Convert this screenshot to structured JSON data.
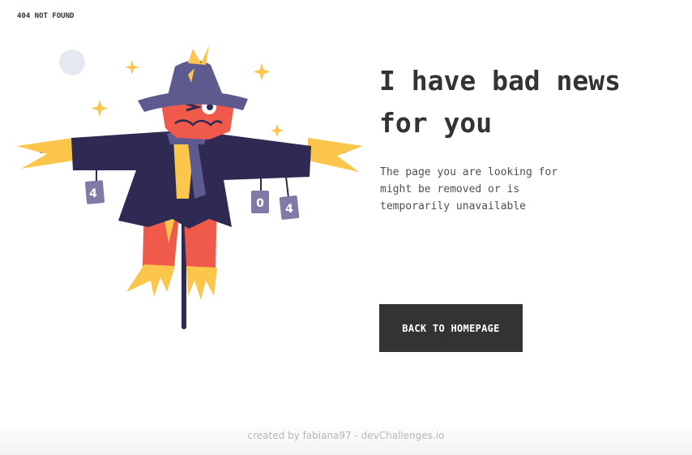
{
  "header": {
    "label": "404 NOT FOUND"
  },
  "illustration": {
    "can_labels": [
      "4",
      "0",
      "4"
    ],
    "colors": {
      "hat": "#5d5a8f",
      "coat": "#2f2a54",
      "face": "#f05a4b",
      "straw": "#fcc54c",
      "sky_dot": "#e6e9f2",
      "can": "#7f7aa6"
    }
  },
  "main": {
    "headline_line1": "I have bad news",
    "headline_line2": "for you",
    "description_line1": "The page you are looking for",
    "description_line2": "might be removed or is",
    "description_line3": "temporarily unavailable",
    "button_label": "BACK TO HOMEPAGE"
  },
  "footer": {
    "credit": "created by fabiana97 - devChallenges.io"
  }
}
